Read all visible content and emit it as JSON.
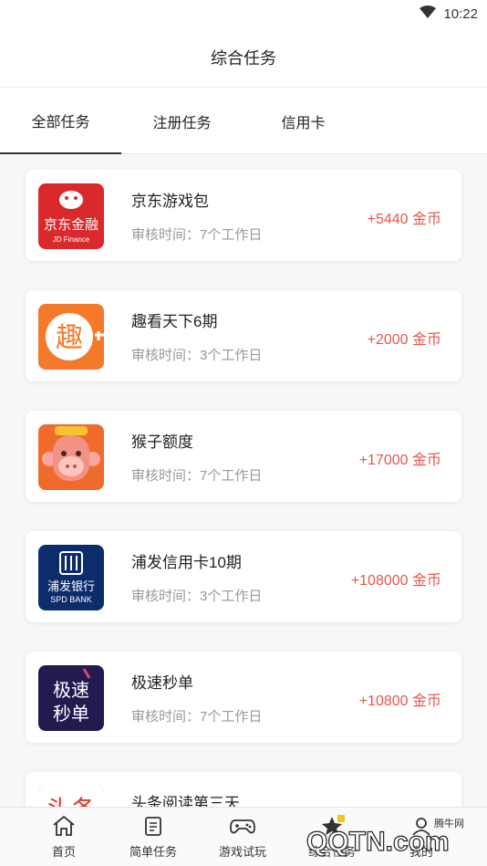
{
  "status_bar": {
    "time": "10:22",
    "wifi_icon": "wifi-icon"
  },
  "header": {
    "title": "综合任务"
  },
  "tabs": [
    {
      "label": "全部任务",
      "active": true
    },
    {
      "label": "注册任务",
      "active": false
    },
    {
      "label": "信用卡",
      "active": false
    }
  ],
  "tasks": [
    {
      "name": "京东游戏包",
      "review": "审核时间：7个工作日",
      "reward": "+5440 金币",
      "logo_text": "京东金融",
      "logo_sub": "JD Finance",
      "logo_color": "#d9292b"
    },
    {
      "name": "趣看天下6期",
      "review": "审核时间：3个工作日",
      "reward": "+2000 金币",
      "logo_text": "趣",
      "logo_color": "#f47a2a"
    },
    {
      "name": "猴子额度",
      "review": "审核时间：7个工作日",
      "reward": "+17000 金币",
      "logo_color": "#f06a2b"
    },
    {
      "name": "浦发信用卡10期",
      "review": "审核时间：3个工作日",
      "reward": "+108000 金币",
      "logo_text": "浦发银行",
      "logo_sub": "SPD BANK",
      "logo_color": "#0c2c6b"
    },
    {
      "name": "极速秒单",
      "review": "审核时间：7个工作日",
      "reward": "+10800 金币",
      "logo_text": "极速秒单",
      "logo_color": "#221b4f"
    },
    {
      "name": "头条阅读第三天",
      "logo_text": "头条",
      "logo_color": "#e23b2e"
    }
  ],
  "bottom_nav": [
    {
      "label": "首页",
      "icon": "home-icon"
    },
    {
      "label": "简单任务",
      "icon": "clipboard-icon"
    },
    {
      "label": "游戏试玩",
      "icon": "gamepad-icon"
    },
    {
      "label": "综合任务",
      "icon": "star-task-icon"
    },
    {
      "label": "我的",
      "icon": "user-icon"
    }
  ],
  "watermark": {
    "text": "QQTN.com",
    "sub": "腾牛网"
  },
  "colors": {
    "reward": "#e8554e",
    "review": "#999999",
    "active_tab_underline": "#333333"
  }
}
